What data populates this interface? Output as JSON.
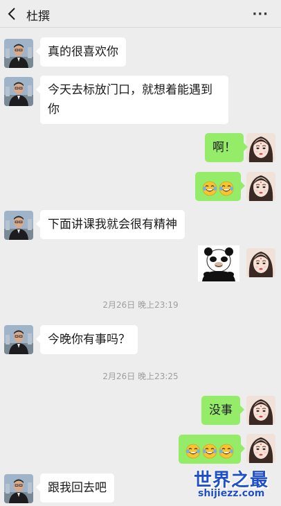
{
  "header": {
    "back_icon": "chevron-left-icon",
    "title": "杜撰",
    "more_icon": "more-dots-icon",
    "more_text": "···"
  },
  "messages": [
    {
      "side": "in",
      "text": "真的很喜欢你"
    },
    {
      "side": "in",
      "text": "今天去标放门口，就想着能遇到你"
    },
    {
      "side": "out",
      "text": "啊！"
    },
    {
      "side": "out",
      "emoji": "laugh-cry-icon",
      "count": 2
    },
    {
      "side": "in",
      "text": "下面讲课我就会很有精神"
    },
    {
      "side": "out",
      "sticker": "panda-meme-sticker"
    },
    {
      "timestamp": "2月26日 晚上23:19"
    },
    {
      "side": "in",
      "text": "今晚你有事吗？"
    },
    {
      "timestamp": "2月26日 晚上23:25"
    },
    {
      "side": "out",
      "text": "没事"
    },
    {
      "side": "out",
      "emoji": "laugh-cry-icon",
      "count": 3
    },
    {
      "side": "in",
      "text": "跟我回去吧"
    }
  ],
  "watermark": {
    "main": "世界之最",
    "sub": "shijiezz.com"
  },
  "colors": {
    "background": "#ededed",
    "outgoing_bubble": "#95ec69",
    "incoming_bubble": "#ffffff",
    "watermark": "#1f4fc9"
  }
}
